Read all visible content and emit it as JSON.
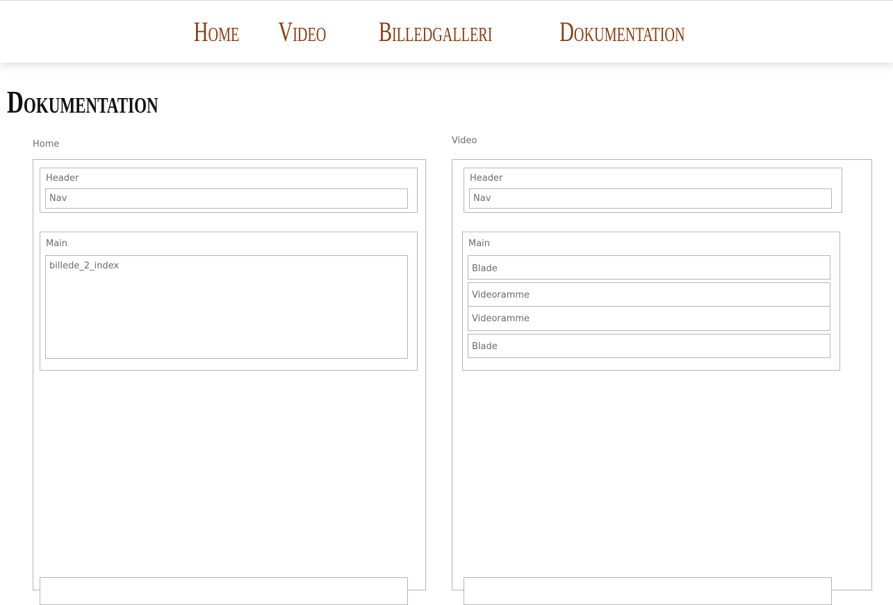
{
  "nav": {
    "links": [
      "Home",
      "Video",
      "Billedgalleri",
      "Dokumentation"
    ],
    "color": "#8a3d12"
  },
  "page": {
    "title": "Dokumentation"
  },
  "panels": {
    "home": {
      "label": "Home",
      "header": {
        "label": "Header",
        "nav": "Nav"
      },
      "main": {
        "label": "Main",
        "image": "billede_2_index"
      }
    },
    "video": {
      "label": "Video",
      "header": {
        "label": "Header",
        "nav": "Nav"
      },
      "main": {
        "label": "Main",
        "items": [
          "Blade",
          "Videoramme",
          "Videoramme",
          "Blade"
        ]
      }
    }
  }
}
